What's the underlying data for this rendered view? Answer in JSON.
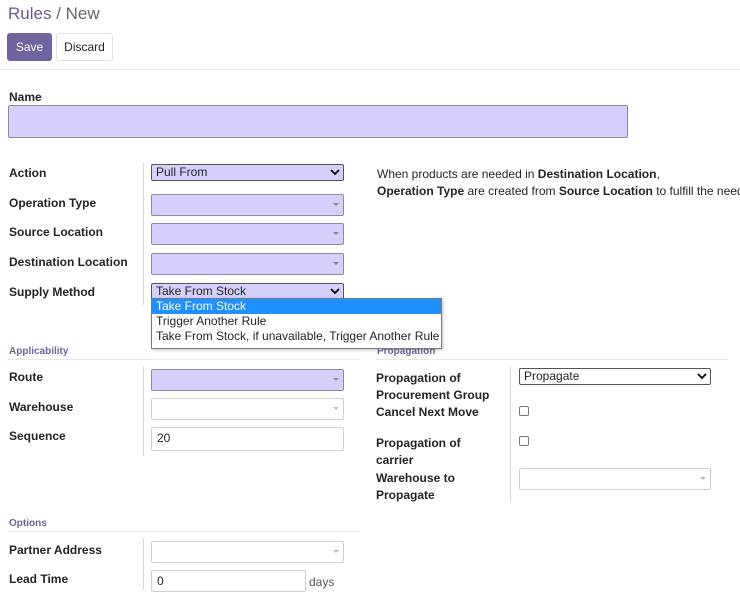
{
  "breadcrumb": {
    "parent": "Rules",
    "separator": " / ",
    "current": "New"
  },
  "toolbar": {
    "save_label": "Save",
    "discard_label": "Discard"
  },
  "form": {
    "name_label": "Name",
    "name_value": "",
    "action_label": "Action",
    "action_value": "Pull From",
    "operation_type_label": "Operation Type",
    "source_location_label": "Source Location",
    "destination_location_label": "Destination Location",
    "supply_method_label": "Supply Method",
    "supply_method_value": "Take From Stock",
    "supply_method_options": [
      "Take From Stock",
      "Trigger Another Rule",
      "Take From Stock, if unavailable, Trigger Another Rule"
    ],
    "help": {
      "line1_a": "When products are needed in ",
      "line1_b": "Destination Location",
      "line1_c": ",",
      "line2_a": "Operation Type",
      "line2_b": " are created from ",
      "line2_c": "Source Location",
      "line2_d": " to fulfill the need."
    }
  },
  "applicability": {
    "title": "Applicability",
    "route_label": "Route",
    "warehouse_label": "Warehouse",
    "sequence_label": "Sequence",
    "sequence_value": "20"
  },
  "propagation": {
    "title": "Propagation",
    "procurement_group_label_1": "Propagation of",
    "procurement_group_label_2": "Procurement Group",
    "procurement_group_value": "Propagate",
    "cancel_next_move_label": "Cancel Next Move",
    "cancel_next_move_checked": false,
    "carrier_label_1": "Propagation of",
    "carrier_label_2": "carrier",
    "carrier_checked": false,
    "warehouse_to_propagate_label_1": "Warehouse to",
    "warehouse_to_propagate_label_2": "Propagate"
  },
  "options": {
    "title": "Options",
    "partner_address_label": "Partner Address",
    "lead_time_label": "Lead Time",
    "lead_time_value": "0",
    "lead_time_unit": "days"
  },
  "colors": {
    "accent": "#71639e",
    "required_field_bg": "#d4d0fb",
    "dropdown_highlight": "#1e90ff"
  },
  "icons": {
    "select_chevron": "chevron-down-icon",
    "many2one_caret": "caret-down-icon"
  }
}
